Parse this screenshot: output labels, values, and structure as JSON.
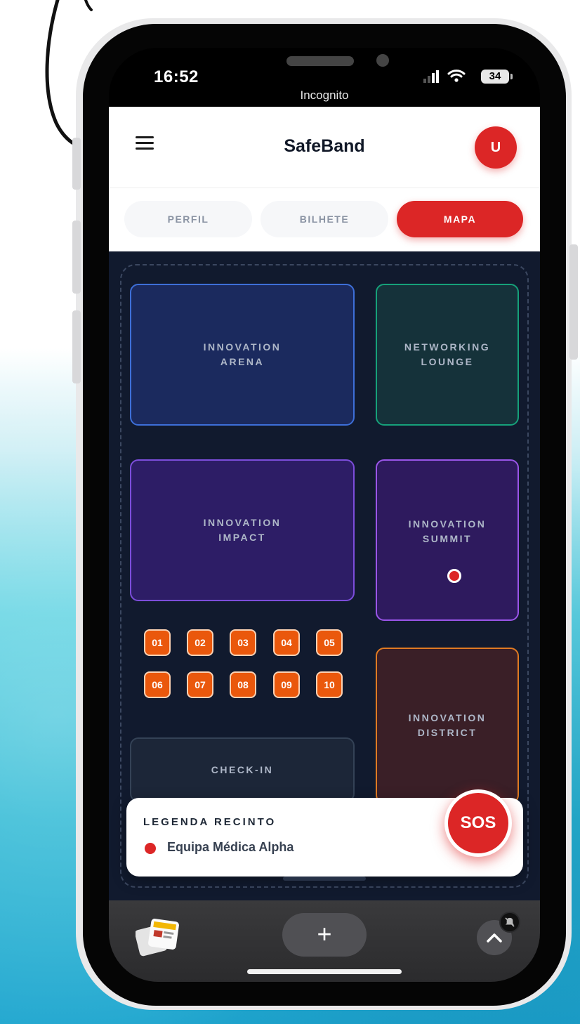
{
  "status_bar": {
    "time": "16:52",
    "browser_mode": "Incognito",
    "battery": "34"
  },
  "app": {
    "title": "SafeBand",
    "avatar_initial": "U"
  },
  "tabs": [
    {
      "label": "PERFIL",
      "active": false
    },
    {
      "label": "BILHETE",
      "active": false
    },
    {
      "label": "MAPA",
      "active": true
    }
  ],
  "map": {
    "zones": {
      "arena": "INNOVATION\nARENA",
      "lounge": "NETWORKING\nLOUNGE",
      "impact": "INNOVATION\nIMPACT",
      "summit": "INNOVATION\nSUMMIT",
      "district": "INNOVATION\nDISTRICT",
      "checkin": "CHECK-IN"
    },
    "booths": [
      "01",
      "02",
      "03",
      "04",
      "05",
      "06",
      "07",
      "08",
      "09",
      "10"
    ]
  },
  "legend": {
    "title": "LEGENDA RECINTO",
    "items": [
      {
        "label": "Equipa Médica Alpha",
        "color": "#dc2626"
      }
    ]
  },
  "sos_label": "SOS",
  "browser_bar": {
    "new_tab_label": "+"
  },
  "colors": {
    "accent": "#dc2626",
    "map_bg": "#111a2e",
    "booth": "#ea580c"
  }
}
